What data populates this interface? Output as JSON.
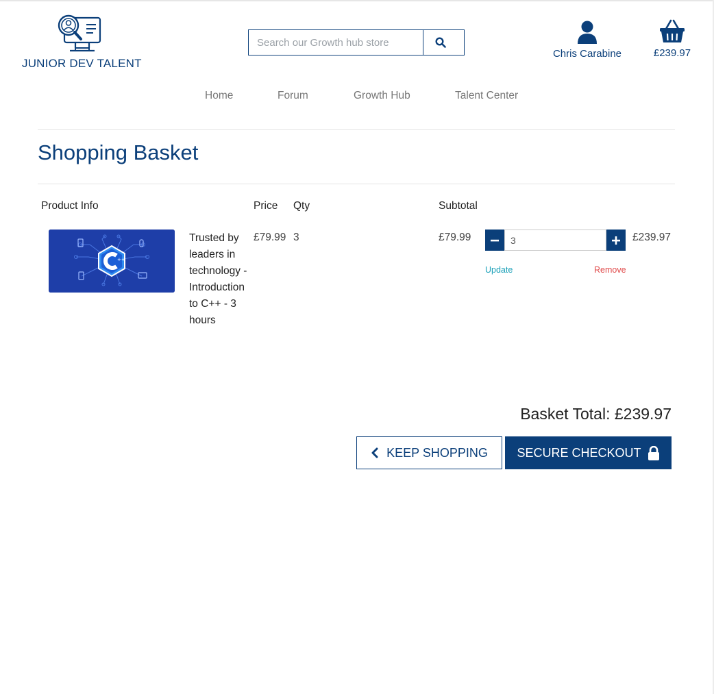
{
  "brand": {
    "name": "JUNIOR DEV TALENT",
    "logo_icon": "monitor-magnifier-icon",
    "color": "#0b3f7a"
  },
  "search": {
    "placeholder": "Search our Growth hub store",
    "value": "",
    "button_icon": "search-icon"
  },
  "user": {
    "name": "Chris Carabine",
    "icon": "user-icon"
  },
  "cart": {
    "total": "£239.97",
    "icon": "basket-icon"
  },
  "nav": {
    "items": [
      {
        "label": "Home"
      },
      {
        "label": "Forum"
      },
      {
        "label": "Growth Hub"
      },
      {
        "label": "Talent Center"
      }
    ]
  },
  "page": {
    "title": "Shopping Basket"
  },
  "table": {
    "headers": {
      "product": "Product Info",
      "price": "Price",
      "qty": "Qty",
      "subtotal": "Subtotal"
    },
    "items": [
      {
        "name": "Trusted by leaders in technology - Introduction to C++ - 3 hours",
        "image_icon": "cpp-course-thumbnail",
        "price": "£79.99",
        "qty": "3",
        "subtotal_unit": "£79.99",
        "qty_input": "3",
        "line_total": "£239.97",
        "update_label": "Update",
        "remove_label": "Remove"
      }
    ]
  },
  "summary": {
    "basket_total": "Basket Total: £239.97"
  },
  "actions": {
    "keep_shopping": "KEEP SHOPPING",
    "secure_checkout": "SECURE CHECKOUT"
  },
  "colors": {
    "primary": "#0b3f7a",
    "update_link": "#1aa0b8",
    "remove_link": "#e04a4a",
    "thumbnail_bg": "#1e3ea8"
  }
}
